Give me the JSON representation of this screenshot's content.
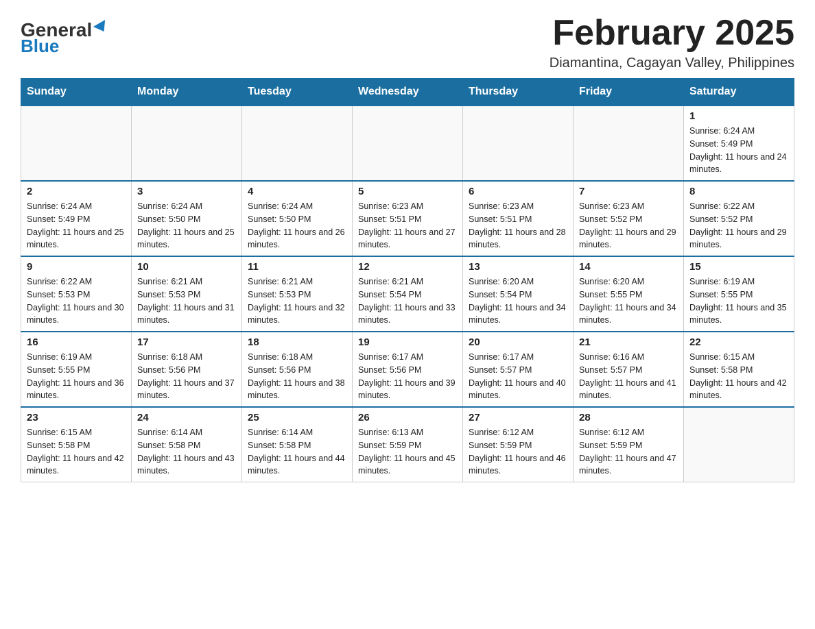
{
  "header": {
    "logo_general": "General",
    "logo_blue": "Blue",
    "month_title": "February 2025",
    "location": "Diamantina, Cagayan Valley, Philippines"
  },
  "weekdays": [
    "Sunday",
    "Monday",
    "Tuesday",
    "Wednesday",
    "Thursday",
    "Friday",
    "Saturday"
  ],
  "weeks": [
    [
      {
        "day": "",
        "info": ""
      },
      {
        "day": "",
        "info": ""
      },
      {
        "day": "",
        "info": ""
      },
      {
        "day": "",
        "info": ""
      },
      {
        "day": "",
        "info": ""
      },
      {
        "day": "",
        "info": ""
      },
      {
        "day": "1",
        "info": "Sunrise: 6:24 AM\nSunset: 5:49 PM\nDaylight: 11 hours and 24 minutes."
      }
    ],
    [
      {
        "day": "2",
        "info": "Sunrise: 6:24 AM\nSunset: 5:49 PM\nDaylight: 11 hours and 25 minutes."
      },
      {
        "day": "3",
        "info": "Sunrise: 6:24 AM\nSunset: 5:50 PM\nDaylight: 11 hours and 25 minutes."
      },
      {
        "day": "4",
        "info": "Sunrise: 6:24 AM\nSunset: 5:50 PM\nDaylight: 11 hours and 26 minutes."
      },
      {
        "day": "5",
        "info": "Sunrise: 6:23 AM\nSunset: 5:51 PM\nDaylight: 11 hours and 27 minutes."
      },
      {
        "day": "6",
        "info": "Sunrise: 6:23 AM\nSunset: 5:51 PM\nDaylight: 11 hours and 28 minutes."
      },
      {
        "day": "7",
        "info": "Sunrise: 6:23 AM\nSunset: 5:52 PM\nDaylight: 11 hours and 29 minutes."
      },
      {
        "day": "8",
        "info": "Sunrise: 6:22 AM\nSunset: 5:52 PM\nDaylight: 11 hours and 29 minutes."
      }
    ],
    [
      {
        "day": "9",
        "info": "Sunrise: 6:22 AM\nSunset: 5:53 PM\nDaylight: 11 hours and 30 minutes."
      },
      {
        "day": "10",
        "info": "Sunrise: 6:21 AM\nSunset: 5:53 PM\nDaylight: 11 hours and 31 minutes."
      },
      {
        "day": "11",
        "info": "Sunrise: 6:21 AM\nSunset: 5:53 PM\nDaylight: 11 hours and 32 minutes."
      },
      {
        "day": "12",
        "info": "Sunrise: 6:21 AM\nSunset: 5:54 PM\nDaylight: 11 hours and 33 minutes."
      },
      {
        "day": "13",
        "info": "Sunrise: 6:20 AM\nSunset: 5:54 PM\nDaylight: 11 hours and 34 minutes."
      },
      {
        "day": "14",
        "info": "Sunrise: 6:20 AM\nSunset: 5:55 PM\nDaylight: 11 hours and 34 minutes."
      },
      {
        "day": "15",
        "info": "Sunrise: 6:19 AM\nSunset: 5:55 PM\nDaylight: 11 hours and 35 minutes."
      }
    ],
    [
      {
        "day": "16",
        "info": "Sunrise: 6:19 AM\nSunset: 5:55 PM\nDaylight: 11 hours and 36 minutes."
      },
      {
        "day": "17",
        "info": "Sunrise: 6:18 AM\nSunset: 5:56 PM\nDaylight: 11 hours and 37 minutes."
      },
      {
        "day": "18",
        "info": "Sunrise: 6:18 AM\nSunset: 5:56 PM\nDaylight: 11 hours and 38 minutes."
      },
      {
        "day": "19",
        "info": "Sunrise: 6:17 AM\nSunset: 5:56 PM\nDaylight: 11 hours and 39 minutes."
      },
      {
        "day": "20",
        "info": "Sunrise: 6:17 AM\nSunset: 5:57 PM\nDaylight: 11 hours and 40 minutes."
      },
      {
        "day": "21",
        "info": "Sunrise: 6:16 AM\nSunset: 5:57 PM\nDaylight: 11 hours and 41 minutes."
      },
      {
        "day": "22",
        "info": "Sunrise: 6:15 AM\nSunset: 5:58 PM\nDaylight: 11 hours and 42 minutes."
      }
    ],
    [
      {
        "day": "23",
        "info": "Sunrise: 6:15 AM\nSunset: 5:58 PM\nDaylight: 11 hours and 42 minutes."
      },
      {
        "day": "24",
        "info": "Sunrise: 6:14 AM\nSunset: 5:58 PM\nDaylight: 11 hours and 43 minutes."
      },
      {
        "day": "25",
        "info": "Sunrise: 6:14 AM\nSunset: 5:58 PM\nDaylight: 11 hours and 44 minutes."
      },
      {
        "day": "26",
        "info": "Sunrise: 6:13 AM\nSunset: 5:59 PM\nDaylight: 11 hours and 45 minutes."
      },
      {
        "day": "27",
        "info": "Sunrise: 6:12 AM\nSunset: 5:59 PM\nDaylight: 11 hours and 46 minutes."
      },
      {
        "day": "28",
        "info": "Sunrise: 6:12 AM\nSunset: 5:59 PM\nDaylight: 11 hours and 47 minutes."
      },
      {
        "day": "",
        "info": ""
      }
    ]
  ]
}
